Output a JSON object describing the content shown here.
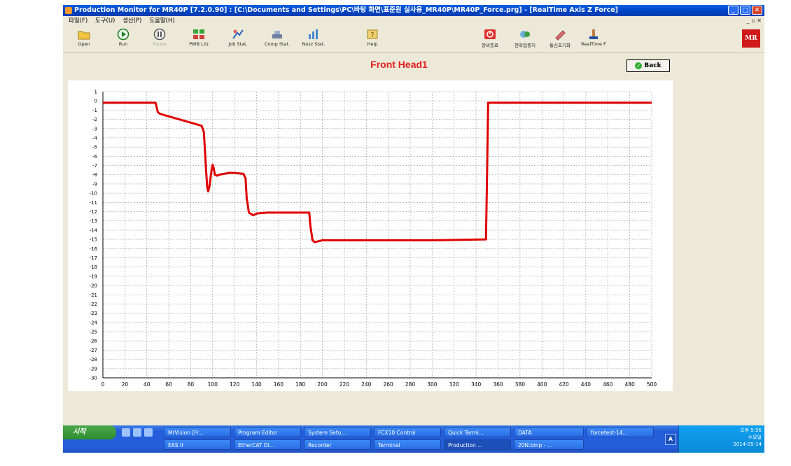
{
  "window": {
    "title": "Production Monitor for MR40P [7.2.0.90] : [C:\\Documents and Settings\\PC\\바탕 화면\\표준원 실사용_MR40P\\MR40P_Force.prg] - [RealTime Axis Z Force]",
    "controls": [
      "_",
      "□",
      "✕"
    ]
  },
  "menu": {
    "items": [
      "파일(F)",
      "도구(U)",
      "생산(P)",
      "도움말(H)"
    ],
    "mdi_controls": "_ ▫ ✕"
  },
  "toolbar": {
    "buttons": [
      {
        "label": "Open",
        "icon": "folder-open-icon",
        "enabled": true
      },
      {
        "label": "Run",
        "icon": "play-icon",
        "enabled": true
      },
      {
        "label": "Pause",
        "icon": "pause-icon",
        "enabled": false
      },
      {
        "label": "PWB L/U",
        "icon": "pwb-load-icon",
        "enabled": true
      },
      {
        "label": "Job Stat.",
        "icon": "job-stat-icon",
        "enabled": true
      },
      {
        "label": "Comp Stat.",
        "icon": "comp-stat-icon",
        "enabled": true
      },
      {
        "label": "Nozz Stat.",
        "icon": "nozzle-stat-icon",
        "enabled": true
      },
      {
        "label": "Help",
        "icon": "help-icon",
        "enabled": true
      },
      {
        "label": "장비종료",
        "icon": "power-off-icon",
        "enabled": true
      },
      {
        "label": "현작업중지",
        "icon": "stop-job-icon",
        "enabled": true
      },
      {
        "label": "통신초기화",
        "icon": "comm-reset-icon",
        "enabled": true
      },
      {
        "label": "RealTime F",
        "icon": "realtime-force-icon",
        "enabled": true
      }
    ],
    "logo_text": "MR"
  },
  "page": {
    "head_title": "Front Head1",
    "back_label": "Back"
  },
  "chart_data": {
    "type": "line",
    "title": "Front Head1",
    "xlabel": "",
    "ylabel": "",
    "xlim": [
      0,
      500
    ],
    "ylim": [
      -30,
      1
    ],
    "x_ticks": [
      0,
      20,
      40,
      60,
      80,
      100,
      120,
      140,
      160,
      180,
      200,
      220,
      240,
      260,
      280,
      300,
      320,
      340,
      360,
      380,
      400,
      420,
      440,
      460,
      480,
      500
    ],
    "y_ticks": [
      1,
      0,
      -1,
      -2,
      -3,
      -4,
      -5,
      -6,
      -7,
      -8,
      -9,
      -10,
      -11,
      -12,
      -13,
      -14,
      -15,
      -16,
      -17,
      -18,
      -19,
      -20,
      -21,
      -22,
      -23,
      -24,
      -25,
      -26,
      -27,
      -28,
      -29,
      -30
    ],
    "grid": true,
    "color": "#e00000",
    "series": [
      {
        "x": [
          0,
          48,
          50,
          52,
          90,
          92,
          94,
          95,
          96,
          97,
          99,
          100,
          101,
          102,
          104,
          106,
          110,
          115,
          120,
          128,
          130,
          131,
          133,
          137,
          140,
          150,
          170,
          188,
          189,
          191,
          193,
          200,
          240,
          300,
          349,
          350,
          351,
          500
        ],
        "y": [
          -0.2,
          -0.2,
          -1.2,
          -1.4,
          -2.7,
          -3.4,
          -7.5,
          -9.3,
          -9.8,
          -9.3,
          -7.5,
          -6.9,
          -7.3,
          -8.0,
          -8.1,
          -8.0,
          -7.9,
          -7.8,
          -7.8,
          -7.9,
          -8.4,
          -10.5,
          -12.1,
          -12.4,
          -12.2,
          -12.1,
          -12.1,
          -12.1,
          -13.5,
          -15.1,
          -15.3,
          -15.1,
          -15.1,
          -15.1,
          -15.0,
          -8.0,
          -0.2,
          -0.2
        ]
      }
    ]
  },
  "taskbar": {
    "start_label": "시작",
    "row1": [
      "MrVision [Fr...",
      "Program Editor",
      "System Setu...",
      "FCX10 Control",
      "Quick Termi...",
      "DATA",
      "forcetest-14..."
    ],
    "row2": [
      "EAS II",
      "EtherCAT Di...",
      "Recorder",
      "Terminal",
      "Production ...",
      "20N.bmp - ..."
    ],
    "lang": "A",
    "clock_time": "오후 5:56",
    "clock_day": "수요일",
    "clock_date": "2014-05-14"
  }
}
